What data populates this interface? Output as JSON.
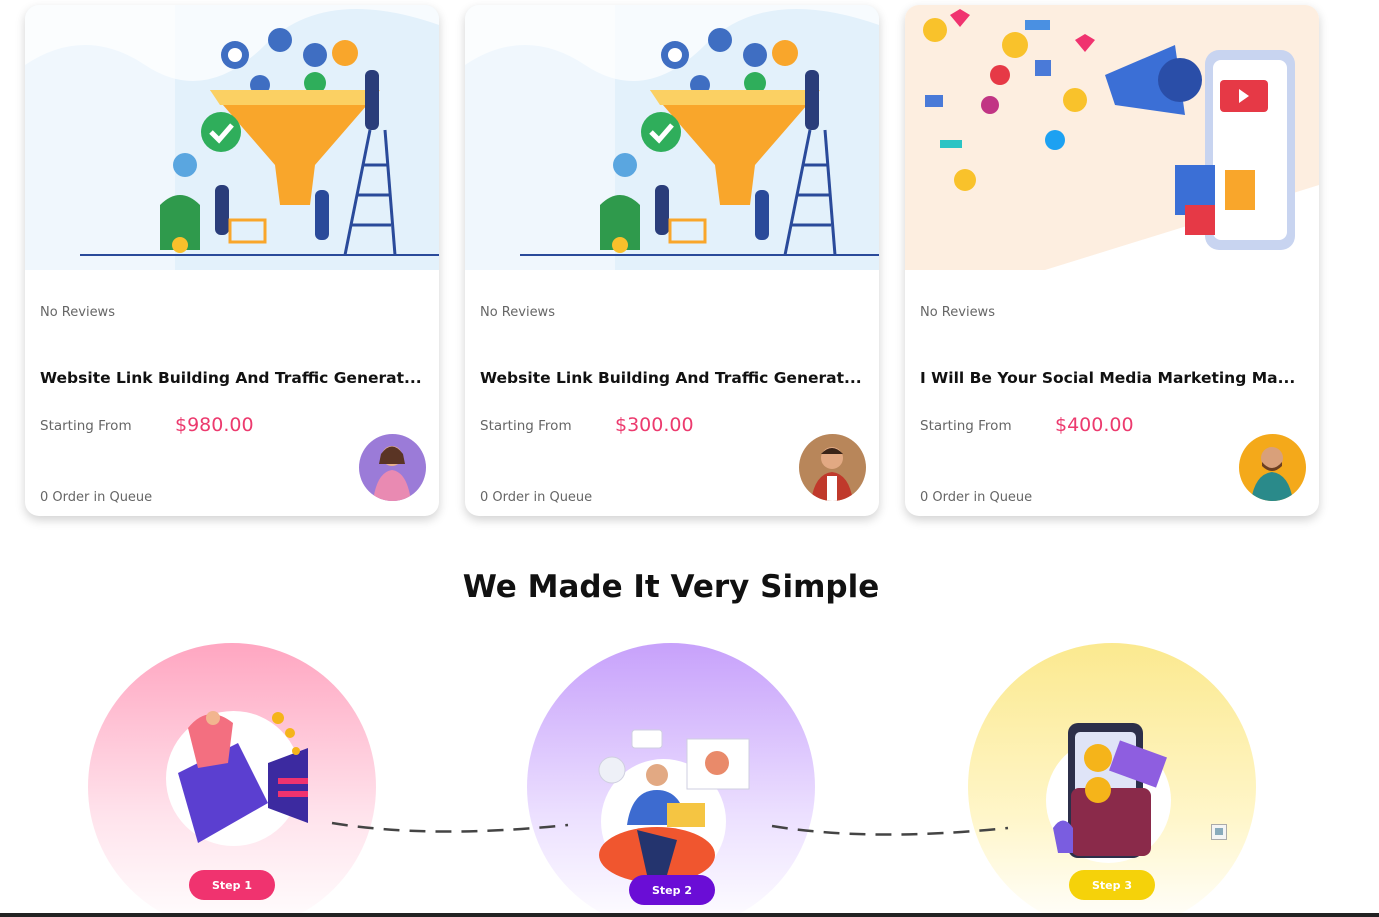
{
  "cards": [
    {
      "reviews": "No Reviews",
      "title": "Website Link Building And Traffic Generat...",
      "starting_label": "Starting From",
      "price": "$980.00",
      "queue": "0 Order in Queue"
    },
    {
      "reviews": "No Reviews",
      "title": "Website Link Building And Traffic Generat...",
      "starting_label": "Starting From",
      "price": "$300.00",
      "queue": "0 Order in Queue"
    },
    {
      "reviews": "No Reviews",
      "title": "I Will Be Your Social Media Marketing Ma...",
      "starting_label": "Starting From",
      "price": "$400.00",
      "queue": "0 Order in Queue"
    }
  ],
  "section": {
    "title": "We Made It Very Simple"
  },
  "steps": [
    {
      "label": "Step 1",
      "color": "#f0336f"
    },
    {
      "label": "Step 2",
      "color": "#6a0dd6"
    },
    {
      "label": "Step 3",
      "color": "#f5d20a"
    }
  ],
  "colors": {
    "price": "#ec3a6e",
    "accent_pink": "#f0336f",
    "accent_purple": "#6a0dd6",
    "accent_yellow": "#f5d20a"
  }
}
